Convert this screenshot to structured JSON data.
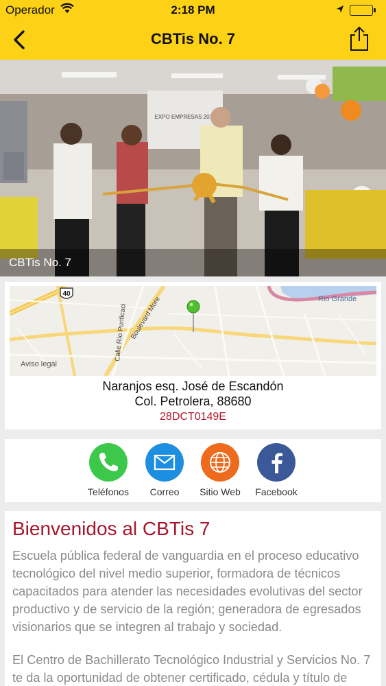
{
  "status": {
    "carrier": "Operador",
    "time": "2:18 PM"
  },
  "nav": {
    "title": "CBTis No. 7"
  },
  "hero": {
    "caption": "CBTis No. 7",
    "banner_text": "EXPO EMPRESAS 2015"
  },
  "map": {
    "road_marker": "40",
    "labels": {
      "rio_grande": "Rio Grande",
      "boulevard": "Boulevard More",
      "calle": "Calle Río Purificaci",
      "legal": "Aviso legal"
    }
  },
  "address": {
    "line1": "Naranjos esq. José de Escandón",
    "line2": "Col. Petrolera, 88680",
    "code": "28DCT0149E"
  },
  "actions": [
    {
      "label": "Teléfonos",
      "icon": "phone-icon",
      "color": "#3cc84a"
    },
    {
      "label": "Correo",
      "icon": "mail-icon",
      "color": "#1e8fe0"
    },
    {
      "label": "Sitio Web",
      "icon": "globe-icon",
      "color": "#ee6a1c"
    },
    {
      "label": "Facebook",
      "icon": "facebook-icon",
      "color": "#3b5998"
    }
  ],
  "welcome": {
    "title": "Bienvenidos al CBTis 7",
    "paragraph1": "Escuela pública federal de vanguardia en el proceso educativo tecnológico del nivel medio superior, formadora de técnicos capacitados para atender las necesidades evolutivas del sector productivo y de servicio de la región; generadora de egresados visionarios que se integren al trabajo y sociedad.",
    "paragraph2": "El Centro de Bachillerato Tecnológico Industrial y Servicios No. 7 te da la oportunidad de obtener certificado, cédula y título de"
  },
  "colors": {
    "brand_yellow": "#fcd116",
    "accent_red": "#a5162c"
  }
}
